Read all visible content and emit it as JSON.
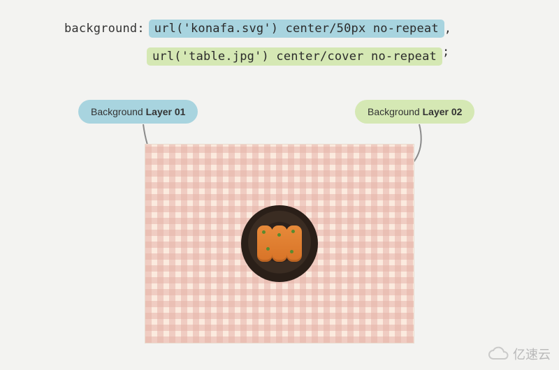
{
  "code": {
    "property": "background:",
    "layer1": "url('konafa.svg') center/50px no-repeat",
    "sep": ",",
    "layer2": "url('table.jpg') center/cover no-repeat",
    "end": ";"
  },
  "labels": {
    "layer1_pre": "Background ",
    "layer1_bold": "Layer 01",
    "layer2_pre": "Background ",
    "layer2_bold": "Layer 02"
  },
  "watermark": "亿速云",
  "colors": {
    "blue": "#a8d4df",
    "green": "#d5e8b4",
    "bg": "#f3f3f1"
  }
}
